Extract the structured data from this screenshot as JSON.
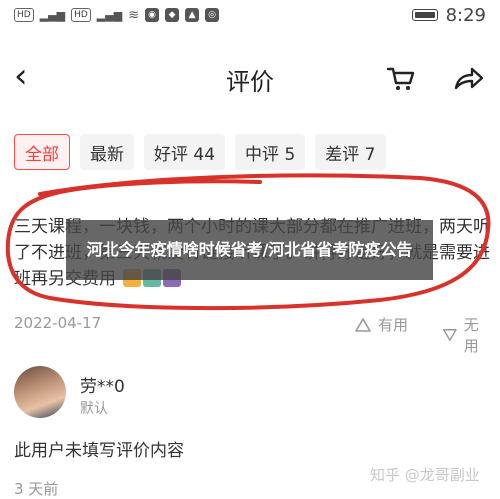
{
  "status_bar": {
    "left_chips": [
      "HD",
      "46",
      "HD",
      "46"
    ],
    "time": "8:29"
  },
  "nav": {
    "title": "评价"
  },
  "filter_tabs": [
    {
      "label": "全部",
      "active": true
    },
    {
      "label": "最新",
      "active": false
    },
    {
      "label": "好评 44",
      "active": false
    },
    {
      "label": "中评 5",
      "active": false
    },
    {
      "label": "差评 7",
      "active": false
    }
  ],
  "review1": {
    "text": "三天课程，一块钱，两个小时的课大部分都在推广进班，两天听了不进班，第三天就没有链接听课了。讲得好是好，就是需要进班再另交费用",
    "date": "2022-04-17",
    "useful_label": "有用",
    "useless_label": "无用"
  },
  "overlay_banner": {
    "text": "河北今年疫情啥时候省考/河北省省考防疫公告"
  },
  "review2": {
    "user": "劳**0",
    "sub": "默认",
    "text": "此用户未填写评价内容",
    "date": "3 天前"
  },
  "watermark": "知乎 @龙哥副业",
  "colors": {
    "accent": "#ff3b3b",
    "scribble": "#d8322b"
  }
}
